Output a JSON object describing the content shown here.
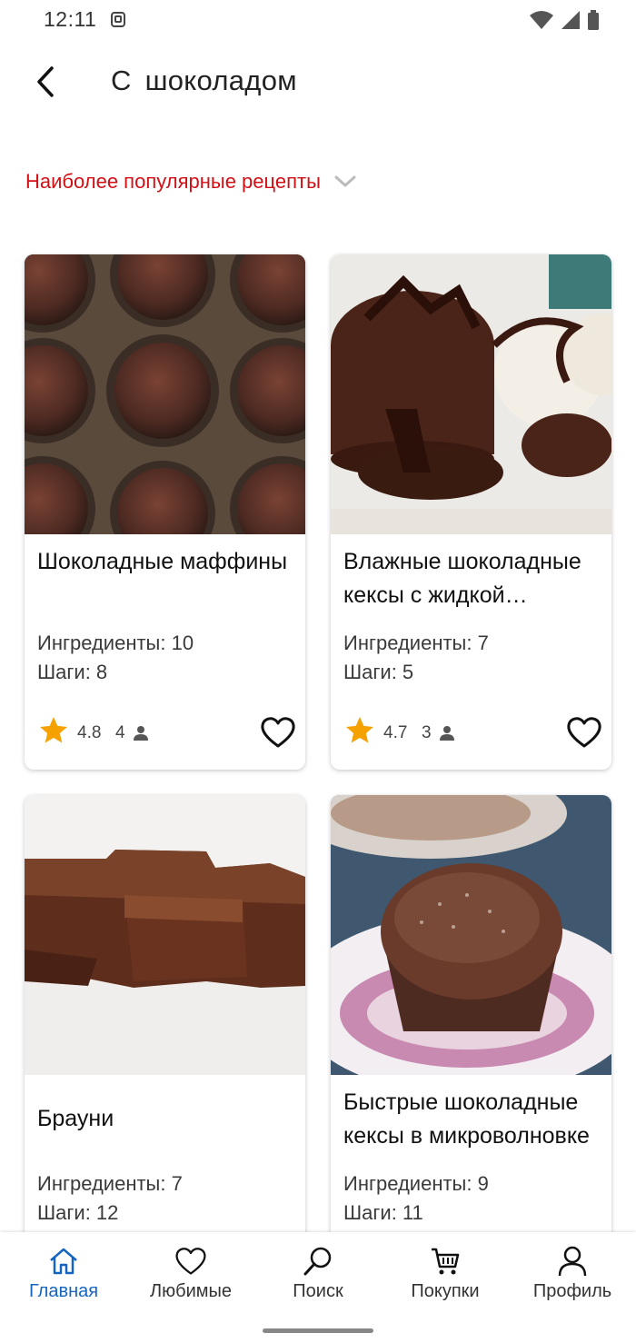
{
  "status_bar": {
    "time": "12:11"
  },
  "header": {
    "title": "С шоколадом"
  },
  "filter": {
    "label": "Наиболее популярные рецепты"
  },
  "recipes": [
    {
      "title": "Шоколадные маффины",
      "ingredients": "Ингредиенты: 10",
      "steps": "Шаги: 8",
      "rating": "4.8",
      "votes": "4"
    },
    {
      "title": "Влажные шоколадные кексы с жидкой начинкой",
      "ingredients": "Ингредиенты: 7",
      "steps": "Шаги: 5",
      "rating": "4.7",
      "votes": "3"
    },
    {
      "title": "Брауни",
      "ingredients": "Ингредиенты: 7",
      "steps": "Шаги: 12"
    },
    {
      "title": "Быстрые шоколадные кексы в микроволновке",
      "ingredients": "Ингредиенты: 9",
      "steps": "Шаги: 11"
    }
  ],
  "bottom_nav": {
    "items": [
      {
        "label": "Главная",
        "icon": "home-icon",
        "active": true
      },
      {
        "label": "Любимые",
        "icon": "heart-icon"
      },
      {
        "label": "Поиск",
        "icon": "search-icon"
      },
      {
        "label": "Покупки",
        "icon": "cart-icon"
      },
      {
        "label": "Профиль",
        "icon": "profile-icon"
      }
    ]
  },
  "colors": {
    "accent": "#d21016",
    "nav_active": "#1565c0",
    "star": "#f5a200"
  }
}
